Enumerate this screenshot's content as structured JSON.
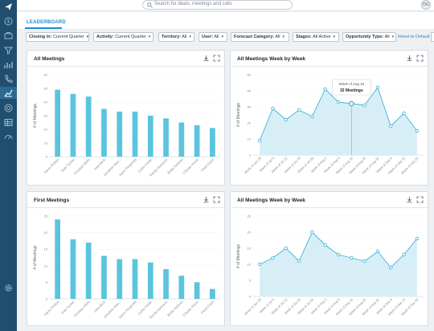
{
  "search": {
    "placeholder": "Search for deals, meetings and calls"
  },
  "user": {
    "initials": "DG"
  },
  "tabs": [
    {
      "label": "LEADERBOARD"
    }
  ],
  "filters": [
    {
      "name": "Closing in",
      "value": "Current Quarter"
    },
    {
      "name": "Activity",
      "value": "Current Quarter"
    },
    {
      "name": "Territory",
      "value": "All"
    },
    {
      "name": "User",
      "value": "All"
    },
    {
      "name": "Forecast Category",
      "value": "All"
    },
    {
      "name": "Stages",
      "value": "All Active"
    },
    {
      "name": "Opportunity Type",
      "value": "All"
    }
  ],
  "reset_label": "Reset to Default",
  "colors": {
    "accent": "#1d8cd0",
    "bar": "#5bc4df",
    "line": "#3fb1d6",
    "area": "#d8eef7",
    "sidebar": "#1f4e6e"
  },
  "sidebar_icons": [
    "logo-icon",
    "dollar-icon",
    "briefcase-icon",
    "filter-icon",
    "bar-chart-icon",
    "phone-icon",
    "leaderboard-icon",
    "target-icon",
    "table-icon",
    "gauge-icon",
    "settings-icon"
  ],
  "panels": {
    "all_meetings": {
      "title": "All Meetings"
    },
    "all_meetings_week": {
      "title": "All Meetings Week by Week"
    },
    "first_meetings": {
      "title": "First Meetings"
    },
    "first_meetings_week": {
      "title": "All Meetings Week by Week"
    }
  },
  "tooltip": {
    "week": "Week of Aug 16",
    "value": "32 Meetings"
  },
  "chart_data": [
    {
      "type": "bar",
      "title": "All Meetings",
      "ylabel": "# of Meetings",
      "ylim": [
        0,
        60
      ],
      "yticks": [
        0,
        10,
        20,
        30,
        40,
        50,
        60
      ],
      "categories": [
        "Aaron Phillips",
        "Dale Tucker",
        "Christian Wells",
        "Jose Beck",
        "Jonathan New...",
        "Jason Fitzgerald",
        "Curtis Foster",
        "Randy Sampson",
        "Bodie Sullivan",
        "Chester Perez",
        "Floyd Grant"
      ],
      "values": [
        49,
        46,
        44,
        35,
        33,
        33,
        30,
        28,
        25,
        23,
        21
      ]
    },
    {
      "type": "area",
      "title": "All Meetings Week by Week",
      "ylabel": "# of Meetings",
      "ylim": [
        0,
        50
      ],
      "yticks": [
        0,
        10,
        20,
        30,
        40,
        50
      ],
      "categories": [
        "Week of Jun 28",
        "Week of Jul 5",
        "Week of Jul 12",
        "Week of Jul 19",
        "Week of Jul 26",
        "Week of Aug 2",
        "Week of Aug 9",
        "Week of Aug 16",
        "Week of Aug 23",
        "Week of Aug 30",
        "Week of Sep 6",
        "Week of Sep 13",
        "Week of Sep 20"
      ],
      "values": [
        9,
        29,
        22,
        28,
        24,
        41,
        33,
        32,
        31,
        42,
        18,
        26,
        15
      ],
      "highlight_index": 7
    },
    {
      "type": "bar",
      "title": "First Meetings",
      "ylabel": "# of Meetings",
      "ylim": [
        0,
        25
      ],
      "yticks": [
        0,
        5,
        10,
        15,
        20,
        25
      ],
      "categories": [
        "Aaron Phillips",
        "Dale Tucker",
        "Christian Wells",
        "Jose Beck",
        "Jonathan New...",
        "Jason Fitzgerald",
        "Curtis Foster",
        "Randy Sampson",
        "Bodie Sullivan",
        "Chester Perez",
        "Floyd Grant"
      ],
      "values": [
        24,
        18,
        17,
        13,
        12,
        12,
        11,
        9,
        7,
        5,
        3
      ]
    },
    {
      "type": "area",
      "title": "All Meetings Week by Week",
      "ylabel": "# of Meetings",
      "ylim": [
        0,
        25
      ],
      "yticks": [
        0,
        5,
        10,
        15,
        20,
        25
      ],
      "categories": [
        "Week of Jun 28",
        "Week of Jul 5",
        "Week of Jul 12",
        "Week of Jul 19",
        "Week of Jul 26",
        "Week of Aug 2",
        "Week of Aug 9",
        "Week of Aug 16",
        "Week of Aug 23",
        "Week of Aug 30",
        "Week of Sep 6",
        "Week of Sep 13",
        "Week of Sep 20"
      ],
      "values": [
        10,
        12,
        15,
        11,
        20,
        16,
        13,
        12,
        11,
        14,
        9,
        13,
        18
      ]
    }
  ]
}
